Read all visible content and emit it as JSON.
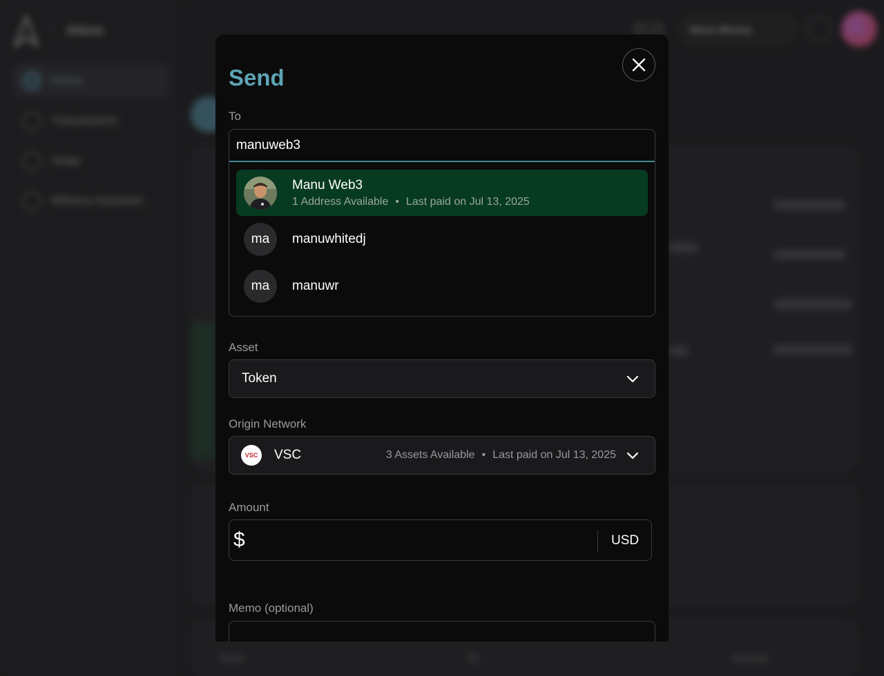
{
  "background": {
    "brand": "Aliens",
    "nav": [
      {
        "label": "Home",
        "icon": "home-icon"
      },
      {
        "label": "Transactions",
        "icon": "receipt-icon"
      },
      {
        "label": "Swap",
        "icon": "swap-icon"
      },
      {
        "label": "Witness Assistant",
        "icon": "globe-icon"
      }
    ],
    "topbar_pill": "Move Money",
    "table_headers": [
      "From",
      "To",
      "Amount"
    ]
  },
  "modal": {
    "title": "Send",
    "to": {
      "label": "To",
      "value": "manuweb3",
      "suggestions": [
        {
          "name": "Manu Web3",
          "addresses": "1 Address Available",
          "last_paid": "Last paid on Jul 13, 2025",
          "avatar": "photo",
          "selected": true
        },
        {
          "name": "manuwhitedj",
          "initials": "ma",
          "selected": false
        },
        {
          "name": "manuwr",
          "initials": "ma",
          "selected": false
        }
      ]
    },
    "asset": {
      "label": "Asset",
      "value": "Token"
    },
    "network": {
      "label": "Origin Network",
      "logo_text": "VSC",
      "name": "VSC",
      "assets": "3 Assets Available",
      "last_paid": "Last paid on Jul 13, 2025"
    },
    "amount": {
      "label": "Amount",
      "symbol": "$",
      "value": "",
      "currency": "USD"
    },
    "memo": {
      "label": "Memo (optional)",
      "value": ""
    },
    "meta_separator": "•"
  },
  "colors": {
    "accent": "#5ea4b4",
    "selected_suggestion": "#073b21",
    "input_focus": "#3f8a8e"
  }
}
